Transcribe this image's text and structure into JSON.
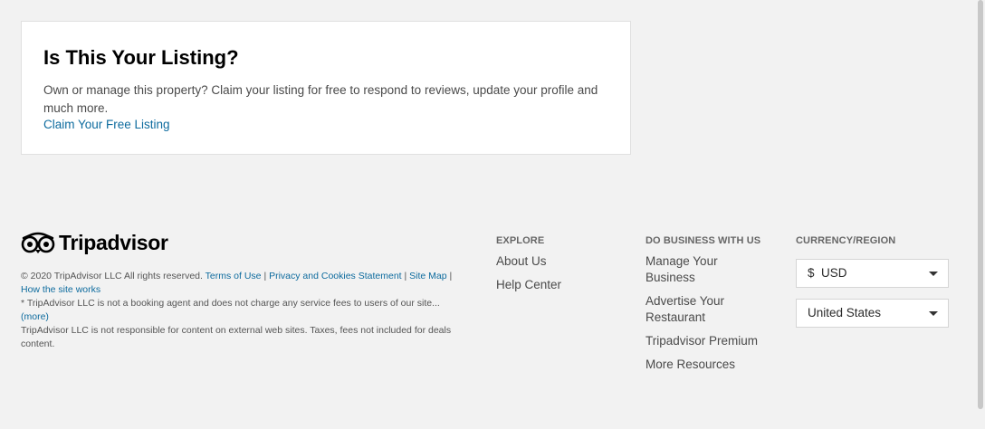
{
  "listing_card": {
    "title": "Is This Your Listing?",
    "description": "Own or manage this property? Claim your listing for free to respond to reviews, update your profile and much more.",
    "claim_link": "Claim Your Free Listing"
  },
  "footer": {
    "logo_text": "Tripadvisor",
    "copyright": "© 2020 TripAdvisor LLC All rights reserved.",
    "links": {
      "terms": "Terms of Use",
      "privacy": "Privacy and Cookies Statement",
      "sitemap": "Site Map",
      "how_works": "How the site works"
    },
    "separator": "|",
    "disclaimer": "* TripAdvisor LLC is not a booking agent and does not charge any service fees to users of our site...",
    "more_link": "(more)",
    "disclaimer2": "TripAdvisor LLC is not responsible for content on external web sites. Taxes, fees not included for deals content.",
    "explore": {
      "heading": "EXPLORE",
      "items": [
        "About Us",
        "Help Center"
      ]
    },
    "business": {
      "heading": "DO BUSINESS WITH US",
      "items": [
        "Manage Your Business",
        "Advertise Your Restaurant",
        "Tripadvisor Premium",
        "More Resources"
      ]
    },
    "currency": {
      "heading": "CURRENCY/REGION",
      "currency_symbol": "$",
      "currency_value": "USD",
      "region_value": "United States"
    }
  }
}
